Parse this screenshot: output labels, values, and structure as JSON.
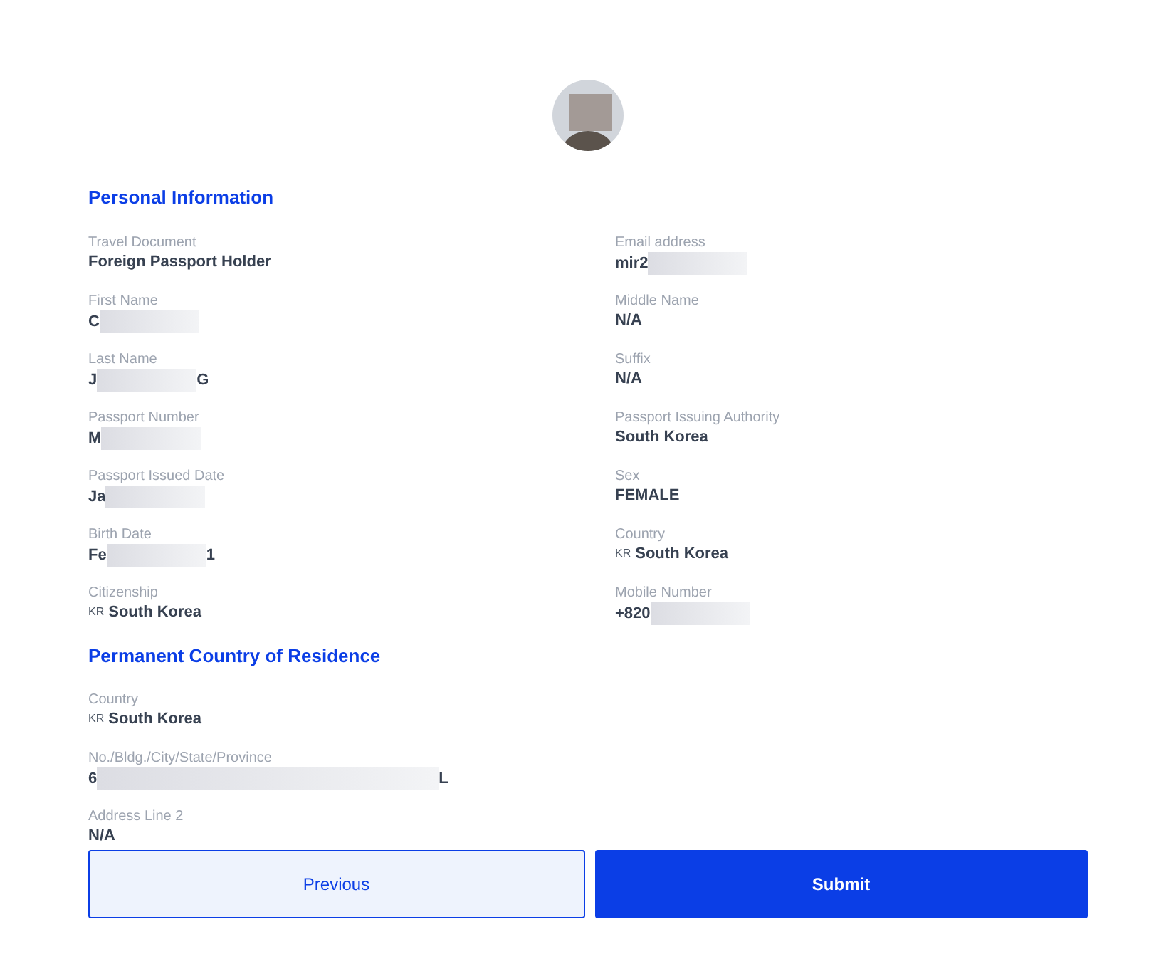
{
  "personal": {
    "title": "Personal Information",
    "fields": [
      {
        "label": "Travel Document",
        "value": "Foreign Passport Holder"
      },
      {
        "label": "Email address",
        "value": "mir2",
        "redacted": true
      },
      {
        "label": "First Name",
        "value": "C",
        "redacted": true
      },
      {
        "label": "Middle Name",
        "value": "N/A"
      },
      {
        "label": "Last Name",
        "value": "J",
        "redacted": true,
        "value_end": "G"
      },
      {
        "label": "Suffix",
        "value": "N/A"
      },
      {
        "label": "Passport Number",
        "value": "M",
        "redacted": true
      },
      {
        "label": "Passport Issuing Authority",
        "value": "South Korea"
      },
      {
        "label": "Passport Issued Date",
        "value": "Ja",
        "redacted": true
      },
      {
        "label": "Sex",
        "value": "FEMALE"
      },
      {
        "label": "Birth Date",
        "value": "Fe",
        "redacted": true,
        "value_end": "1"
      },
      {
        "label": "Country",
        "code": "KR",
        "value": "South Korea"
      },
      {
        "label": "Citizenship",
        "code": "KR",
        "value": "South Korea"
      },
      {
        "label": "Mobile Number",
        "value": "+820",
        "redacted": true
      }
    ]
  },
  "residence": {
    "title": "Permanent Country of Residence",
    "fields": [
      {
        "label": "Country",
        "code": "KR",
        "value": "South Korea"
      },
      {
        "label": "No./Bldg./City/State/Province",
        "value": "6",
        "redacted": true,
        "value_end": "L"
      },
      {
        "label": "Address Line 2",
        "value": "N/A"
      }
    ]
  },
  "buttons": [
    {
      "label": "Previous",
      "kind": "secondary"
    },
    {
      "label": "Submit",
      "kind": "primary"
    }
  ]
}
